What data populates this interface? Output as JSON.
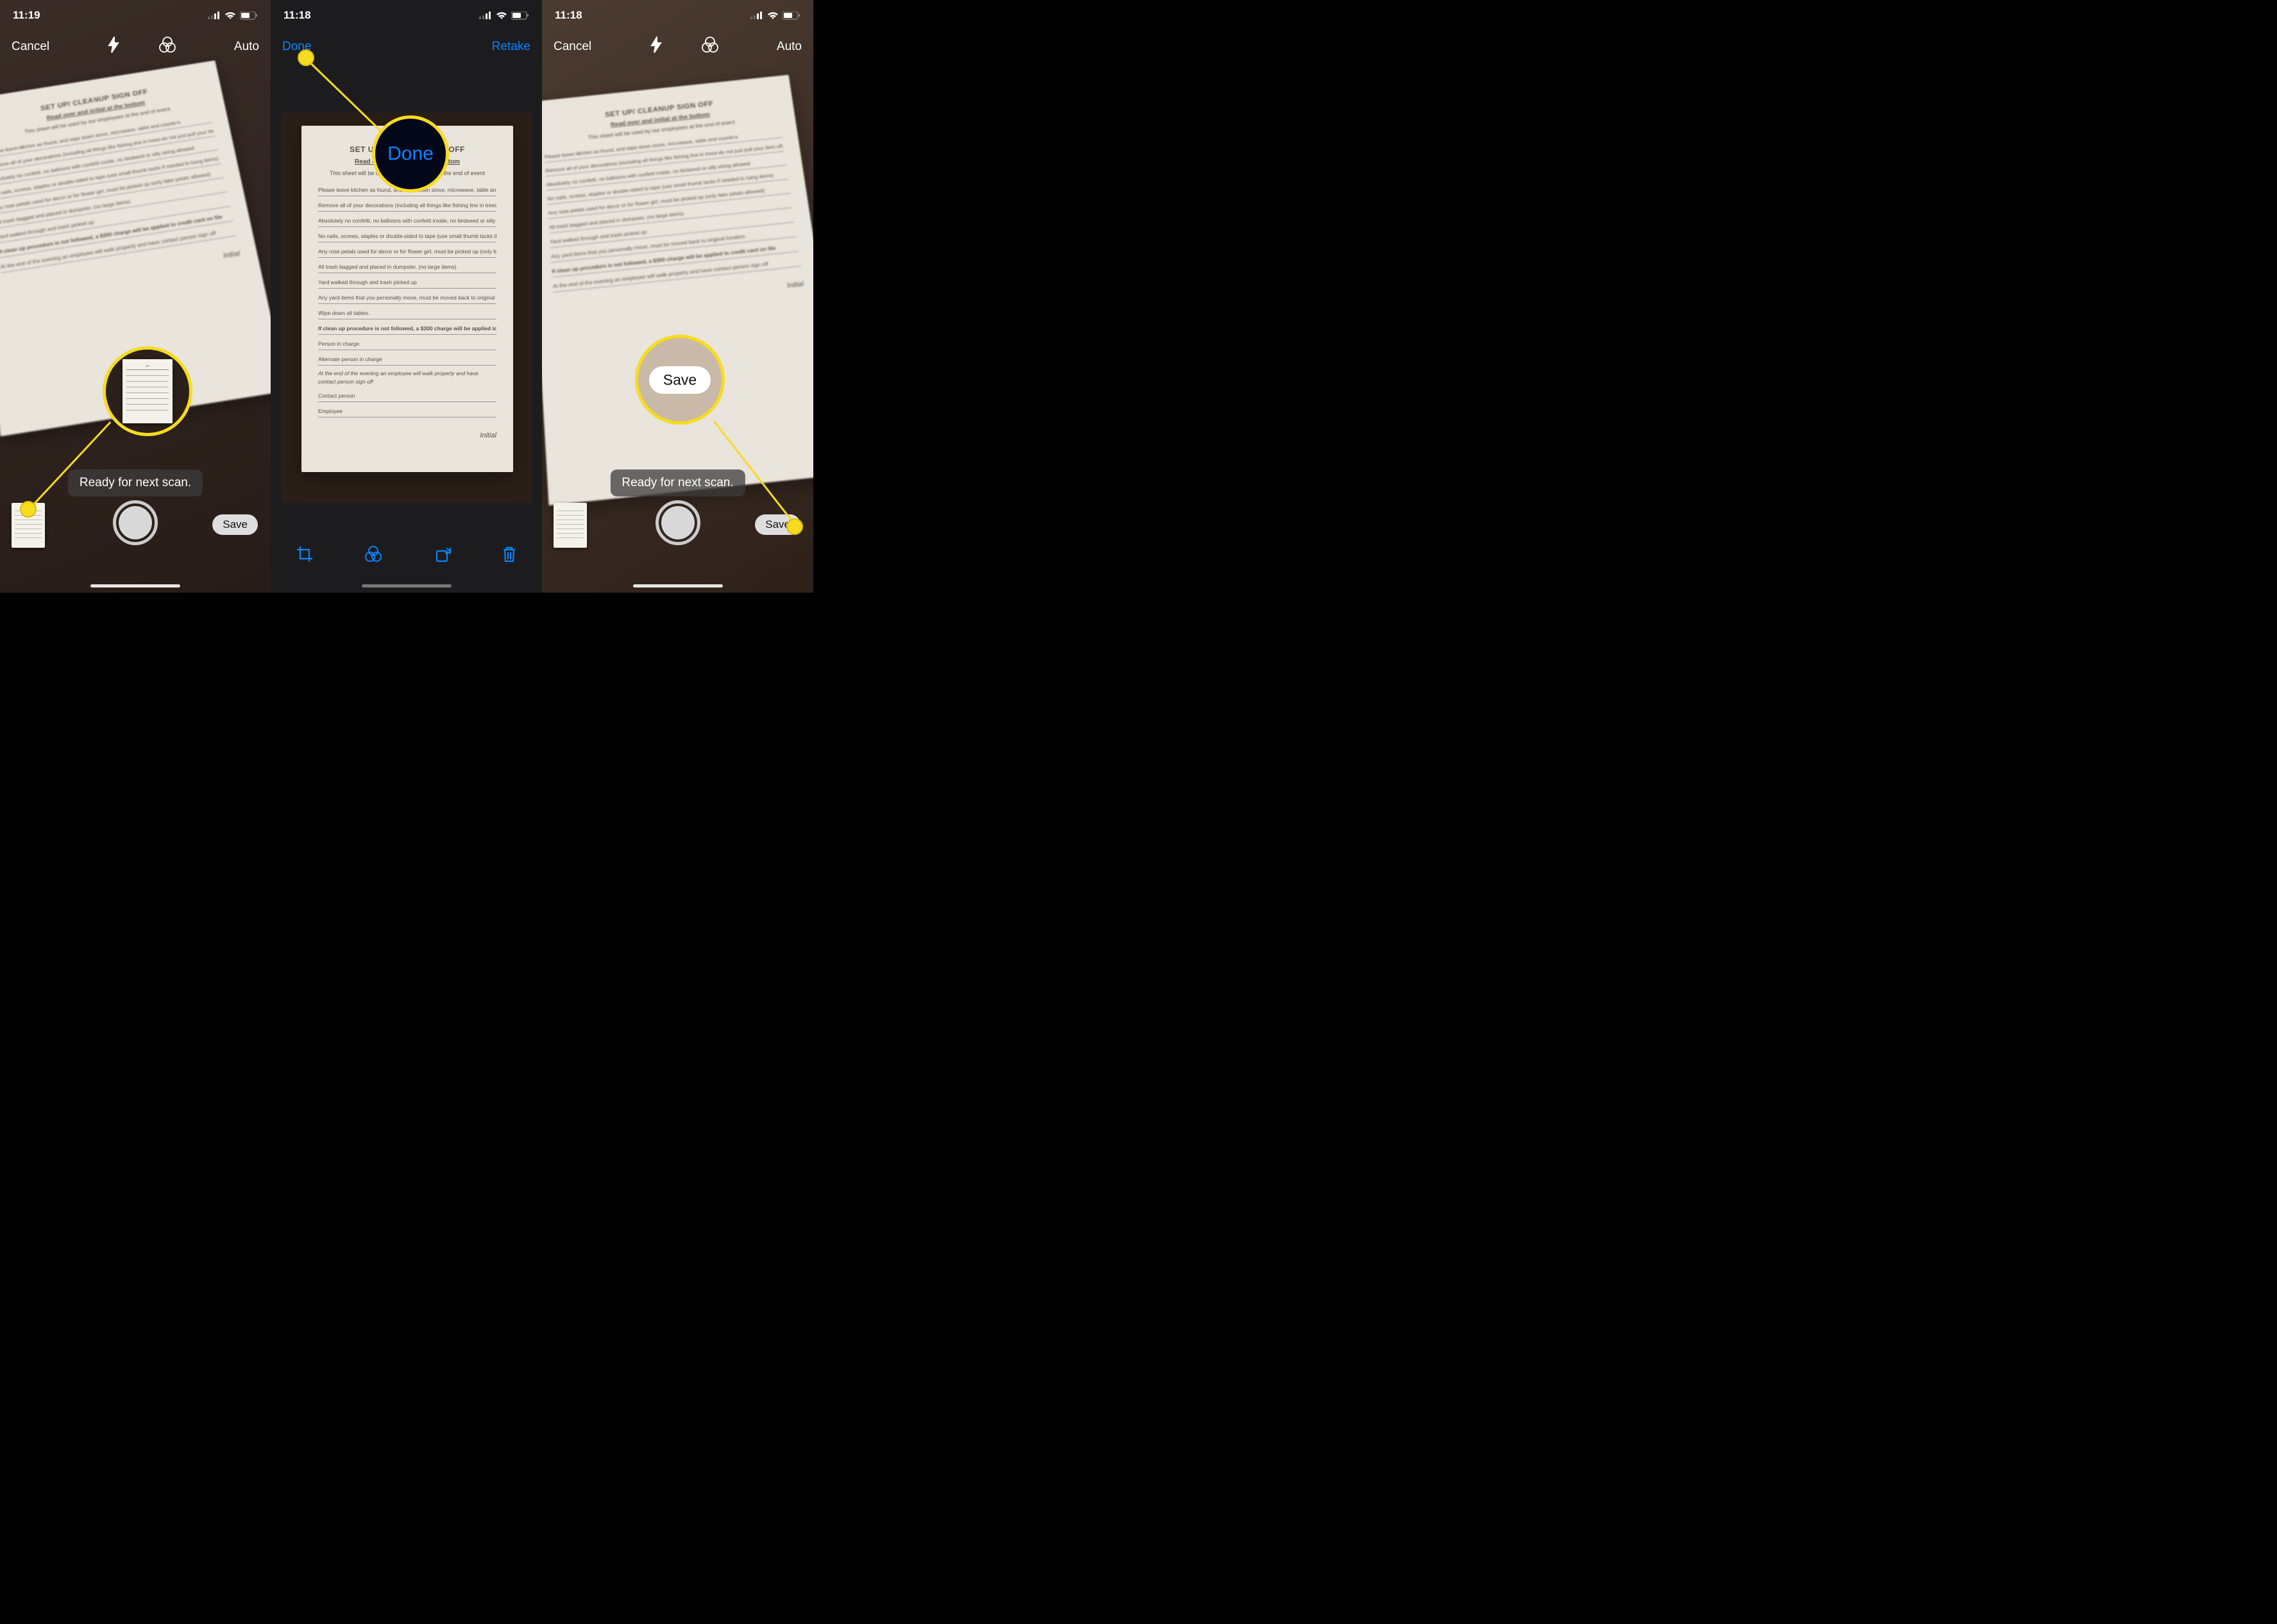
{
  "panel1": {
    "time": "11:19",
    "toolbar": {
      "cancel": "Cancel",
      "auto": "Auto"
    },
    "toast": "Ready for next scan.",
    "save": "Save"
  },
  "panel2": {
    "time": "11:18",
    "toolbar": {
      "done": "Done",
      "retake": "Retake"
    },
    "callout_done": "Done"
  },
  "panel3": {
    "time": "11:18",
    "toolbar": {
      "cancel": "Cancel",
      "auto": "Auto"
    },
    "toast": "Ready for next scan.",
    "save": "Save",
    "callout_save": "Save"
  },
  "doc": {
    "title": "SET UP/ CLEANUP SIGN OFF",
    "subtitle": "Read over and initial at the bottom",
    "note": "This sheet will be used by our employees at the end of event",
    "lines": [
      "Please leave kitchen as found, and wipe down stove, microwave, table and counters",
      "Remove all of your decorations (including all things like fishing line in trees-do not just pull your item off, ect.)",
      "Absolutely no confetti, no balloons with confetti inside, no birdseed or silly string allowed",
      "No nails, screws, staples or double-sided to tape (use small thumb tacks if needed to hang items)",
      "Any rose petals used for decor or for flower girl, must be picked up (only fake petals allowed)",
      "All trash bagged and placed in dumpster, (no large items)",
      "Yard walked through and trash picked up",
      "Any yard items that you personally move, must be moved back to original location.",
      "Wipe down all tables."
    ],
    "warn": "If clean up procedure is not followed, a $300 charge will be applied to credit card on file",
    "person_in_charge": "Person in charge",
    "alternate": "Alternate person in charge",
    "closing": "At the end of the evening an employee will walk property and have contact person sign off",
    "contact": "Contact person",
    "employee": "Employee",
    "initial": "Initial"
  }
}
